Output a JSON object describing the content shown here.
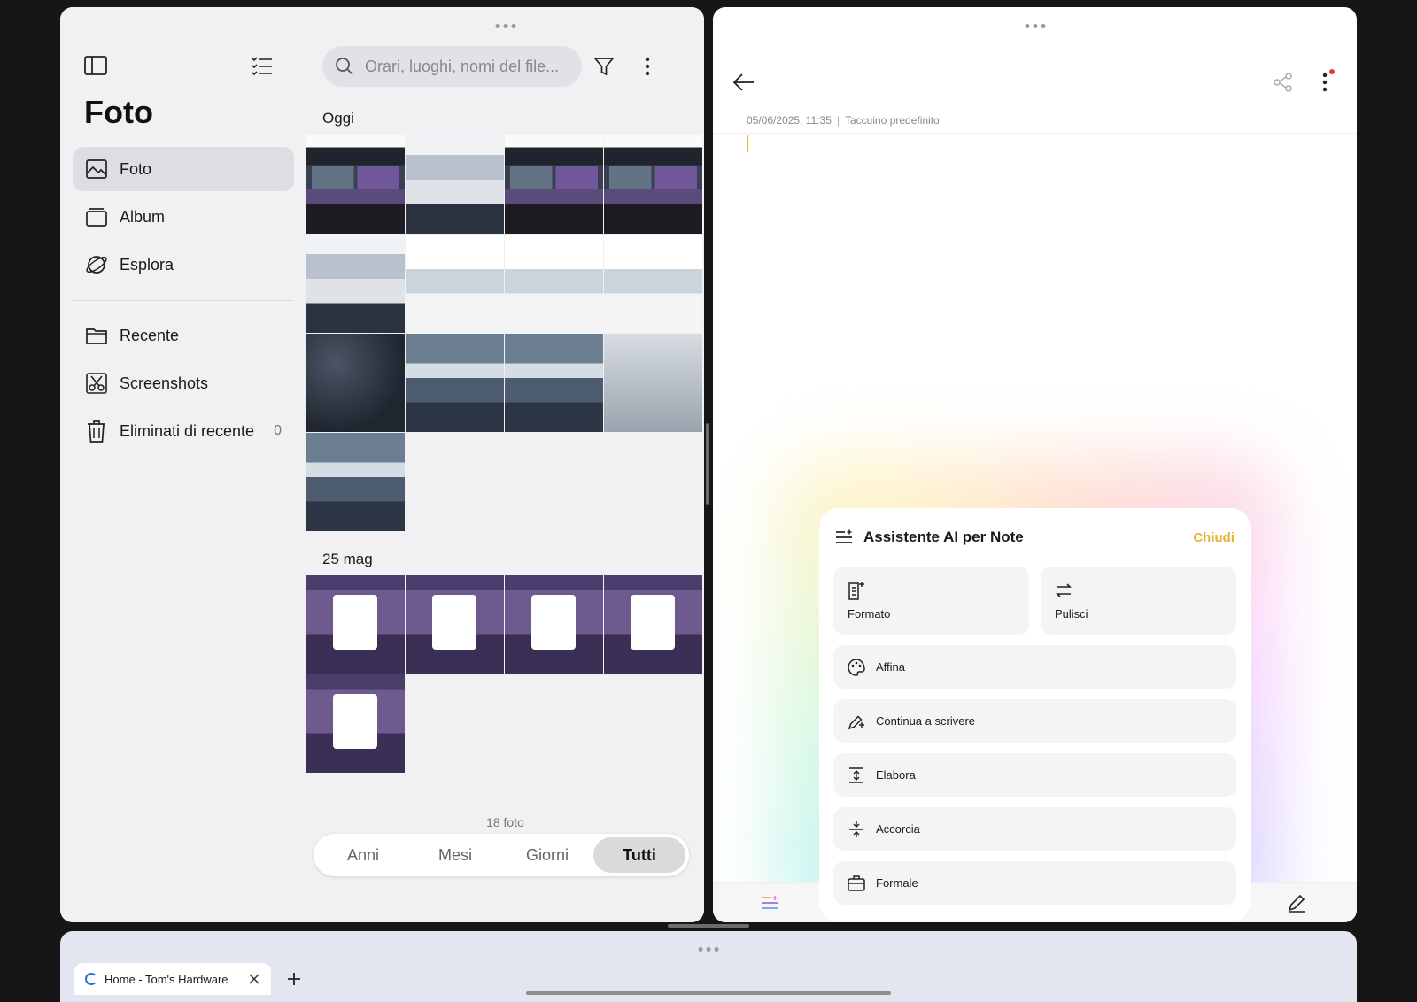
{
  "photos": {
    "title": "Foto",
    "nav": [
      {
        "label": "Foto",
        "icon": "photo-icon",
        "active": true
      },
      {
        "label": "Album",
        "icon": "album-icon"
      },
      {
        "label": "Esplora",
        "icon": "explore-icon"
      }
    ],
    "nav2": [
      {
        "label": "Recente",
        "icon": "folder-icon"
      },
      {
        "label": "Screenshots",
        "icon": "scissors-icon"
      },
      {
        "label": "Eliminati di recente",
        "icon": "trash-icon",
        "count": "0"
      }
    ],
    "search_placeholder": "Orari, luoghi, nomi del file...",
    "sections": [
      {
        "title": "Oggi"
      },
      {
        "title": "25 mag"
      }
    ],
    "photo_count": "18 foto",
    "view_tabs": [
      "Anni",
      "Mesi",
      "Giorni",
      "Tutti"
    ],
    "active_view": "Tutti"
  },
  "notes": {
    "meta_date": "05/06/2025, 11:35",
    "meta_sep": "|",
    "meta_notebook": "Taccuino predefinito",
    "ai": {
      "title": "Assistente AI per Note",
      "close": "Chiudi",
      "tiles": [
        "Formato",
        "Pulisci"
      ],
      "rows": [
        "Affina",
        "Continua a scrivere",
        "Elabora",
        "Accorcia",
        "Formale"
      ]
    }
  },
  "browser": {
    "tab_title": "Home - Tom's Hardware"
  },
  "colors": {
    "accent": "#e9b233",
    "notification_dot": "#e53935"
  }
}
